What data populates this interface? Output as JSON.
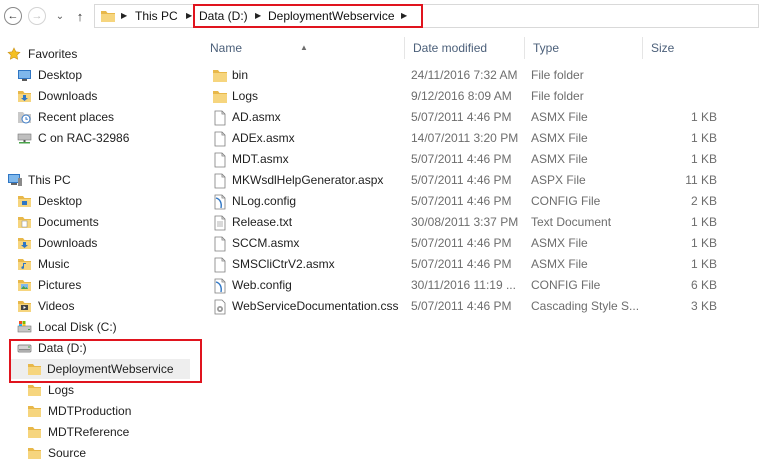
{
  "toolbar": {
    "back_glyph": "←",
    "forward_glyph": "→",
    "recent_glyph": "⌄",
    "up_glyph": "↑"
  },
  "address": {
    "crumbs": [
      "This PC",
      "Data (D:)",
      "DeploymentWebservice"
    ],
    "highlight_color": "#e0141e"
  },
  "nav": {
    "favorites": {
      "label": "Favorites",
      "items": [
        "Desktop",
        "Downloads",
        "Recent places",
        "C on RAC-32986"
      ]
    },
    "this_pc": {
      "label": "This PC",
      "items": [
        "Desktop",
        "Documents",
        "Downloads",
        "Music",
        "Pictures",
        "Videos",
        "Local Disk (C:)",
        "Data (D:)"
      ]
    },
    "data_children": [
      "DeploymentWebservice",
      "Logs",
      "MDTProduction",
      "MDTReference",
      "Source"
    ]
  },
  "columns": [
    "Name",
    "Date modified",
    "Type",
    "Size"
  ],
  "files": [
    {
      "name": "bin",
      "date": "24/11/2016 7:32 AM",
      "type": "File folder",
      "size": "",
      "icon": "folder-icon"
    },
    {
      "name": "Logs",
      "date": "9/12/2016 8:09 AM",
      "type": "File folder",
      "size": "",
      "icon": "folder-icon"
    },
    {
      "name": "AD.asmx",
      "date": "5/07/2011 4:46 PM",
      "type": "ASMX File",
      "size": "1 KB",
      "icon": "file-icon"
    },
    {
      "name": "ADEx.asmx",
      "date": "14/07/2011 3:20 PM",
      "type": "ASMX File",
      "size": "1 KB",
      "icon": "file-icon"
    },
    {
      "name": "MDT.asmx",
      "date": "5/07/2011 4:46 PM",
      "type": "ASMX File",
      "size": "1 KB",
      "icon": "file-icon"
    },
    {
      "name": "MKWsdlHelpGenerator.aspx",
      "date": "5/07/2011 4:46 PM",
      "type": "ASPX File",
      "size": "11 KB",
      "icon": "file-icon"
    },
    {
      "name": "NLog.config",
      "date": "5/07/2011 4:46 PM",
      "type": "CONFIG File",
      "size": "2 KB",
      "icon": "config-file-icon"
    },
    {
      "name": "Release.txt",
      "date": "30/08/2011 3:37 PM",
      "type": "Text Document",
      "size": "1 KB",
      "icon": "text-file-icon"
    },
    {
      "name": "SCCM.asmx",
      "date": "5/07/2011 4:46 PM",
      "type": "ASMX File",
      "size": "1 KB",
      "icon": "file-icon"
    },
    {
      "name": "SMSCliCtrV2.asmx",
      "date": "5/07/2011 4:46 PM",
      "type": "ASMX File",
      "size": "1 KB",
      "icon": "file-icon"
    },
    {
      "name": "Web.config",
      "date": "30/11/2016 11:19 ...",
      "type": "CONFIG File",
      "size": "6 KB",
      "icon": "config-file-icon"
    },
    {
      "name": "WebServiceDocumentation.css",
      "date": "5/07/2011 4:46 PM",
      "type": "Cascading Style S...",
      "size": "3 KB",
      "icon": "css-file-icon"
    }
  ]
}
